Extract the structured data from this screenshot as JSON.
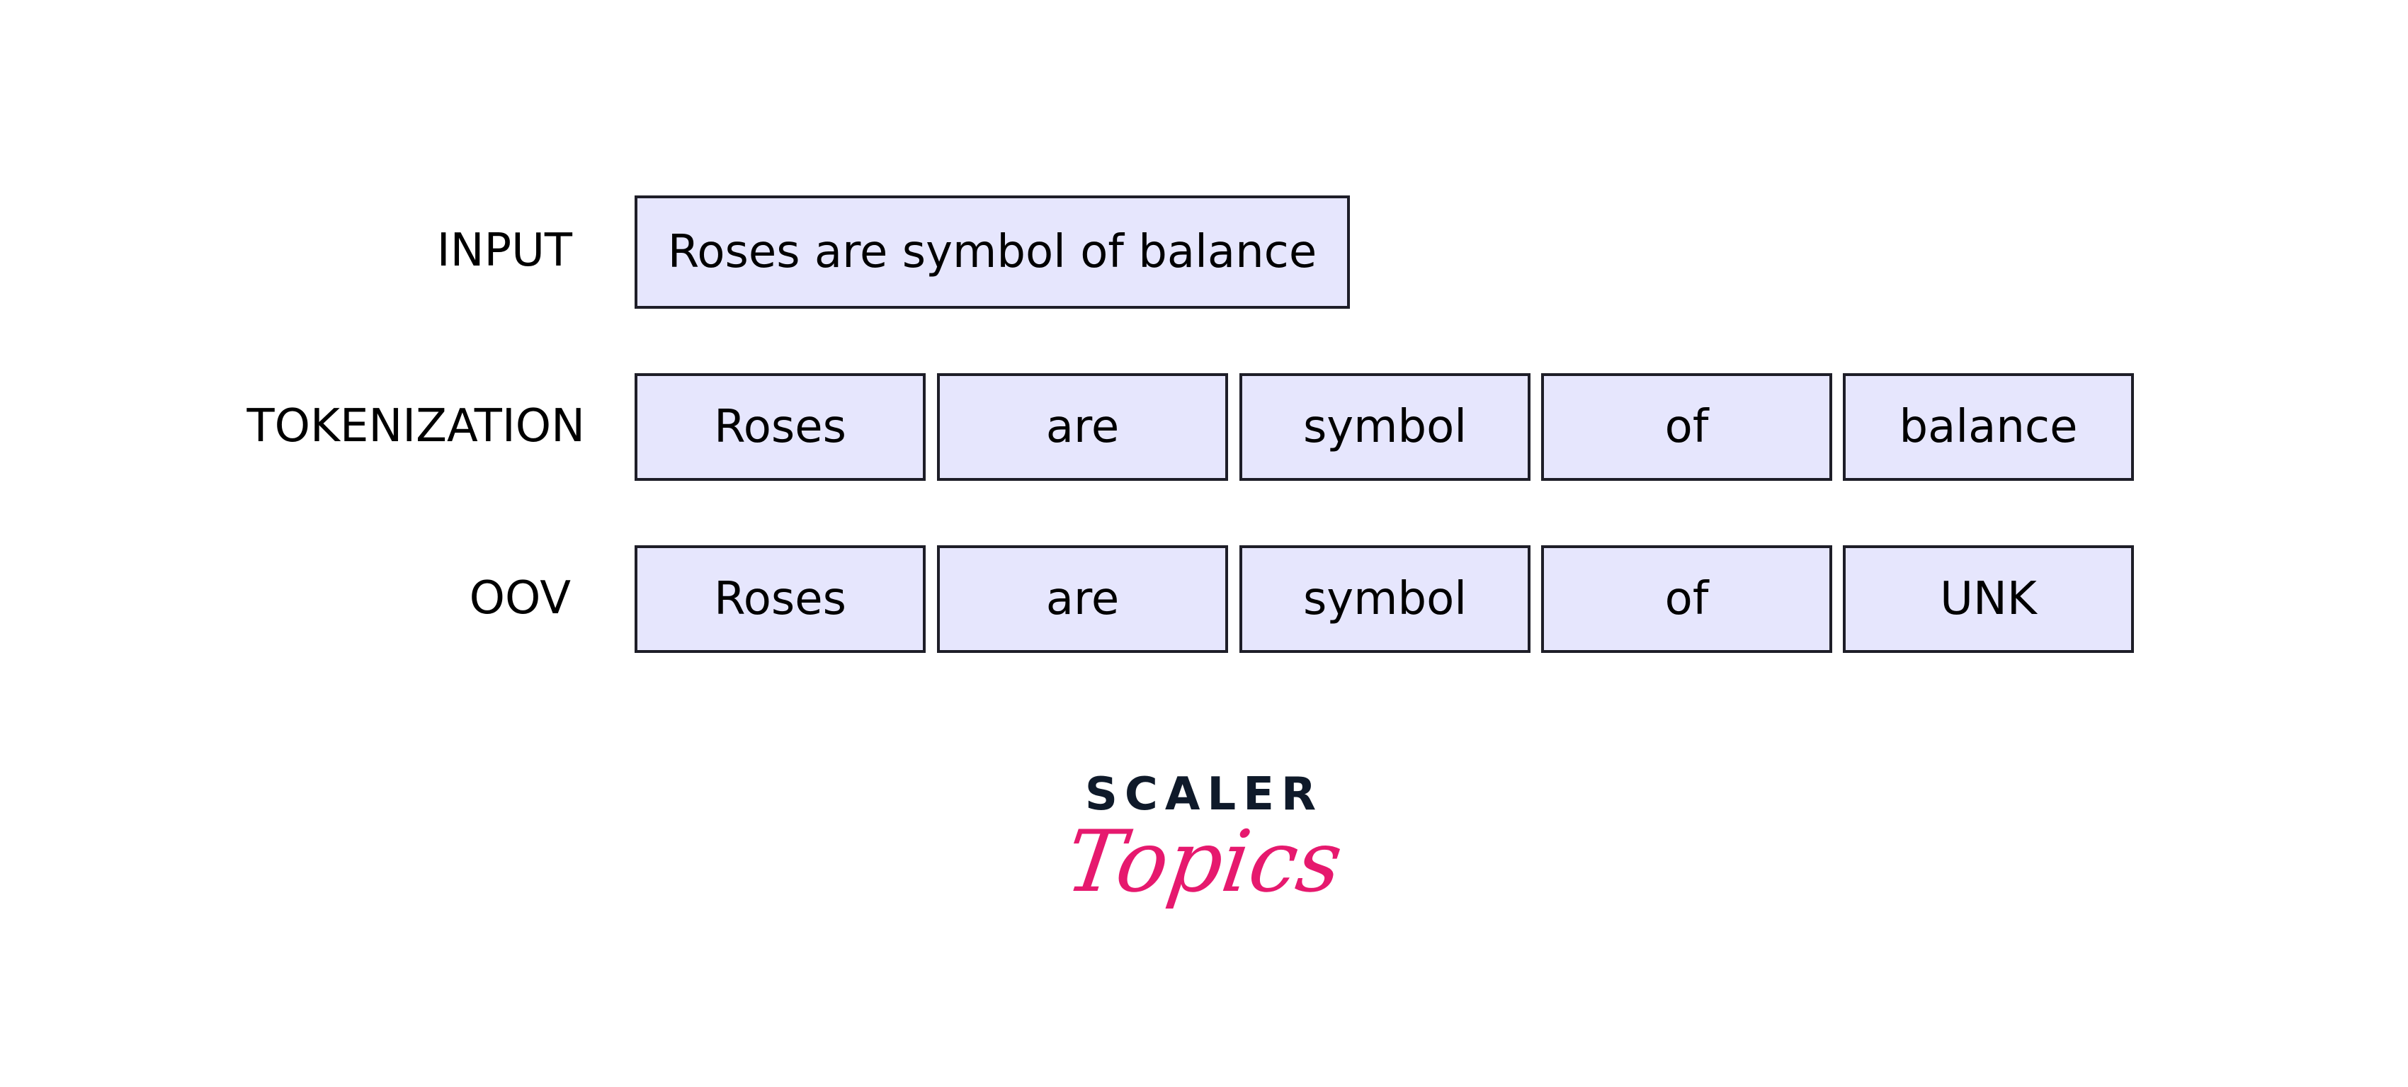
{
  "rows": [
    {
      "label": "INPUT",
      "tokens": [
        "Roses are symbol of balance"
      ]
    },
    {
      "label": "TOKENIZATION",
      "tokens": [
        "Roses",
        "are",
        "symbol",
        "of",
        "balance"
      ]
    },
    {
      "label": "OOV",
      "tokens": [
        "Roses",
        "are",
        "symbol",
        "of",
        "UNK"
      ]
    }
  ],
  "logo": {
    "line1": "SCALER",
    "line2": "Topics"
  },
  "colors": {
    "box_fill": "#e6e6fd",
    "box_border": "#1e1e28",
    "logo_dark": "#0f1a2a",
    "logo_pink": "#e6196e"
  }
}
